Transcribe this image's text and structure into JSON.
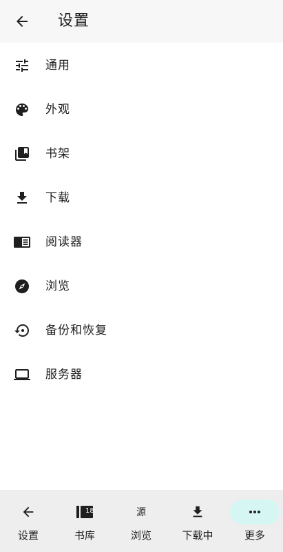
{
  "header": {
    "title": "设置"
  },
  "settings": [
    {
      "label": "通用",
      "icon": "tune-icon"
    },
    {
      "label": "外观",
      "icon": "palette-icon"
    },
    {
      "label": "书架",
      "icon": "bookshelf-icon"
    },
    {
      "label": "下载",
      "icon": "download-icon"
    },
    {
      "label": "阅读器",
      "icon": "reader-icon"
    },
    {
      "label": "浏览",
      "icon": "compass-icon"
    },
    {
      "label": "备份和恢复",
      "icon": "restore-icon"
    },
    {
      "label": "服务器",
      "icon": "laptop-icon"
    }
  ],
  "bottom_nav": [
    {
      "label": "设置",
      "icon": "back-arrow-icon"
    },
    {
      "label": "书库",
      "icon": "library-icon",
      "icon_text": "18"
    },
    {
      "label": "浏览",
      "icon": "browse-icon",
      "icon_text": "源"
    },
    {
      "label": "下载中",
      "icon": "download-icon"
    },
    {
      "label": "更多",
      "icon": "more-icon",
      "active": true
    }
  ],
  "colors": {
    "accent": "#d6f6f4",
    "icon": "#1f1f1f",
    "header_bg": "#f7f7f7",
    "nav_bg": "#eeeeee"
  }
}
